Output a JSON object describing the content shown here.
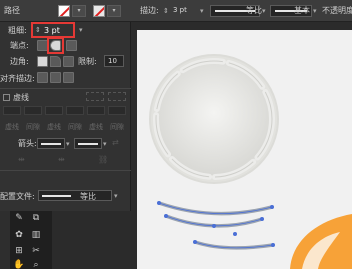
{
  "control_bar": {
    "path_label": "路径",
    "stroke_label": "描边:",
    "stroke_weight": "3 pt",
    "profile_label": "等比",
    "brush_label": "基本",
    "opacity_label": "不透明度"
  },
  "stroke_panel": {
    "weight_label": "粗细:",
    "weight_value": "3 pt",
    "cap_label": "端点:",
    "corner_label": "边角:",
    "limit_label": "限制:",
    "limit_value": "10",
    "align_label": "对齐描边:",
    "dashed_label": "虚线",
    "dash_cells": [
      "虚线",
      "间隙",
      "虚线",
      "间隙",
      "虚线",
      "间隙"
    ],
    "arrowheads_label": "箭头:",
    "profile_label": "配置文件:",
    "profile_value": "等比"
  },
  "colors": {
    "highlight": "#e53935",
    "panel_bg": "#323232",
    "orange": "#f7a238"
  }
}
